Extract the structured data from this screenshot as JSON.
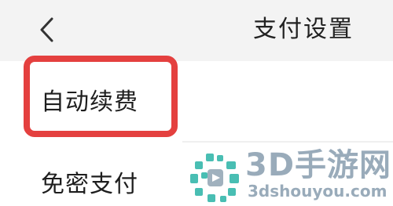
{
  "header": {
    "title": "支付设置",
    "back_icon": "chevron-left-icon"
  },
  "menu": {
    "items": [
      {
        "label": "自动续费",
        "highlighted": true
      },
      {
        "label": "免密支付",
        "highlighted": false
      }
    ]
  },
  "annotation": {
    "color": "#e4403f"
  },
  "watermark": {
    "name": "3D手游网",
    "url": "3dshouyou.com",
    "color": "#8fa3b3",
    "logo_accent": "#2ab3a6"
  }
}
